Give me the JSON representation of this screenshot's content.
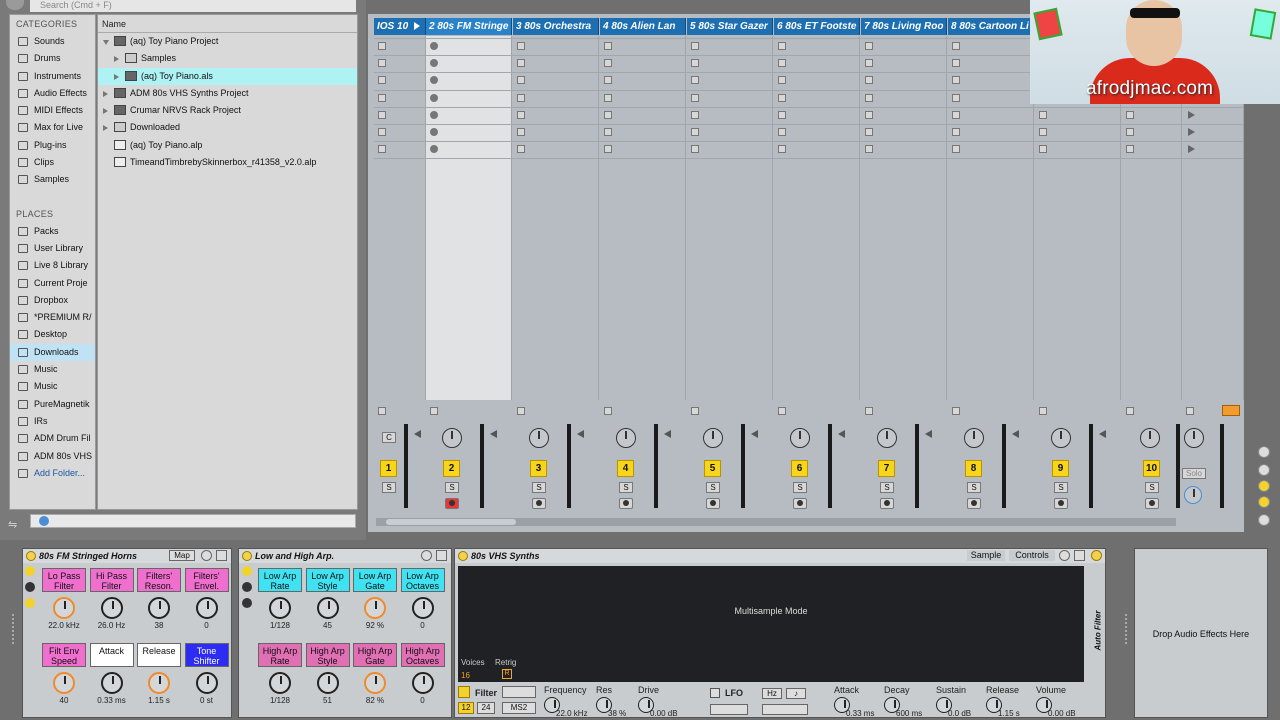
{
  "browser": {
    "search_placeholder": "Search (Cmd + F)",
    "categories_header": "CATEGORIES",
    "categories": [
      "Sounds",
      "Drums",
      "Instruments",
      "Audio Effects",
      "MIDI Effects",
      "Max for Live",
      "Plug-ins",
      "Clips",
      "Samples"
    ],
    "places_header": "PLACES",
    "places": [
      "Packs",
      "User Library",
      "Live 8 Library",
      "Current Proje",
      "Dropbox",
      "*PREMIUM R/",
      "Desktop",
      "Downloads",
      "Music",
      "Music",
      "PureMagnetik",
      "IRs",
      "ADM Drum Fil",
      "ADM 80s VHS"
    ],
    "add_folder": "Add Folder...",
    "files_header": "Name",
    "files": [
      "(aq) Toy Piano Project",
      "Samples",
      "(aq) Toy Piano.als",
      "ADM 80s VHS Synths Project",
      "Crumar NRVS Rack Project",
      "Downloaded",
      "(aq) Toy Piano.alp",
      "TimeandTimbrebySkinnerbox_r41358_v2.0.alp"
    ]
  },
  "session": {
    "tracks": [
      "IOS 10",
      "2 80s FM Stringe",
      "3 80s Orchestra",
      "4 80s Alien Lan",
      "5 80s Star Gazer",
      "6 80s ET Footste",
      "7 80s Living Roo",
      "8 80s Cartoon Li"
    ],
    "track_numbers": [
      "1",
      "2",
      "3",
      "4",
      "5",
      "6",
      "7",
      "8",
      "9",
      "10"
    ],
    "solo_label": "S",
    "master_solo": "Solo",
    "cue_label": "C"
  },
  "webcam": {
    "logo": "afrodjmac.com"
  },
  "devices": {
    "fm": {
      "title": "80s FM Stringed Horns",
      "map_label": "Map",
      "macros_top": [
        {
          "label": "Lo Pass Filter",
          "value": "22.0 kHz"
        },
        {
          "label": "Hi Pass Filter",
          "value": "26.0 Hz"
        },
        {
          "label": "Filters' Reson.",
          "value": "38"
        },
        {
          "label": "Filters' Envel.",
          "value": "0"
        }
      ],
      "macros_bottom": [
        {
          "label": "Filt Env Speed",
          "value": "40"
        },
        {
          "label": "Attack",
          "value": "0.33 ms"
        },
        {
          "label": "Release",
          "value": "1.15 s"
        },
        {
          "label": "Tone Shifter",
          "value": "0 st"
        }
      ]
    },
    "arp": {
      "title": "Low and High Arp.",
      "macros_top": [
        {
          "label": "Low Arp Rate",
          "value": "1/128"
        },
        {
          "label": "Low Arp Style",
          "value": "45"
        },
        {
          "label": "Low Arp Gate",
          "value": "92 %"
        },
        {
          "label": "Low Arp Octaves",
          "value": "0"
        }
      ],
      "macros_bottom": [
        {
          "label": "High Arp Rate",
          "value": "1/128"
        },
        {
          "label": "High Arp Style",
          "value": "51"
        },
        {
          "label": "High Arp Gate",
          "value": "82 %"
        },
        {
          "label": "High Arp Octaves",
          "value": "0"
        }
      ]
    },
    "synth": {
      "title": "80s VHS Synths",
      "tab_sample": "Sample",
      "tab_controls": "Controls",
      "mode_text": "Multisample Mode",
      "voices_label": "Voices",
      "voices_value": "16",
      "retrig_label": "Retrig",
      "retrig_value": "R",
      "filter_label": "Filter",
      "filter_num1": "12",
      "filter_num2": "24",
      "filter_type": "MS2",
      "frequency_label": "Frequency",
      "frequency_value": "22.0 kHz",
      "res_label": "Res",
      "res_value": "38 %",
      "drive_label": "Drive",
      "drive_value": "0.00 dB",
      "lfo_label": "LFO",
      "hz_label": "Hz",
      "note_label": "♪",
      "attack_label": "Attack",
      "attack_value": "0.33 ms",
      "decay_label": "Decay",
      "decay_value": "600 ms",
      "sustain_label": "Sustain",
      "sustain_value": "0.0 dB",
      "release_label": "Release",
      "release_value": "1.15 s",
      "volume_label": "Volume",
      "volume_value": "0.00 dB"
    },
    "auto_filter_label": "Auto Filter",
    "drop_text": "Drop Audio Effects Here"
  }
}
